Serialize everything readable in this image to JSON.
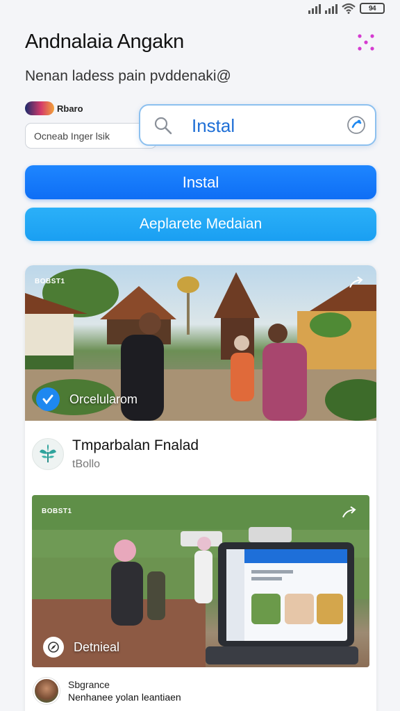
{
  "status_bar": {
    "battery_label": "94"
  },
  "header": {
    "app_title": "Andnalaia Angakn",
    "subtitle": "Nenan ladess pain pvddenaki@"
  },
  "brand": {
    "name": "Rbaro"
  },
  "secondary_input": {
    "value": "Ocneab Inger lsik"
  },
  "search": {
    "value": "Instal"
  },
  "buttons": {
    "primary_label": "Instal",
    "secondary_label": "Aeplarete Medaian"
  },
  "feed": {
    "photo1": {
      "tag": "BOBST1",
      "caption": "Orcelularom"
    },
    "post": {
      "title": "Tmparbalan Fnalad",
      "subtitle": "tBollo"
    },
    "photo2": {
      "tag": "BOBST1",
      "caption": "Detnieal"
    },
    "user": {
      "name": "Sbgrance",
      "description": "Nenhanee yolan leantiaen"
    }
  },
  "colors": {
    "primary_button": "#0e6ef5",
    "secondary_button": "#1a9ff2",
    "search_border": "#8cc0ef",
    "accent_text": "#1f6fd6"
  },
  "icons": {
    "menu": "dots-grid-icon",
    "search": "search-icon",
    "voice": "mic-icon",
    "share": "share-arrow-icon",
    "verified": "check-icon",
    "compass": "compass-icon"
  }
}
